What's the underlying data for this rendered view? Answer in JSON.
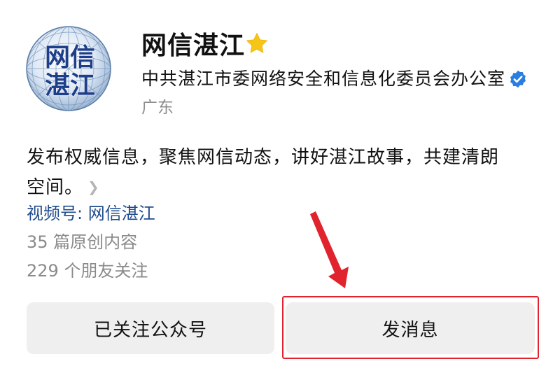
{
  "account": {
    "name": "网信湛江",
    "organization": "中共湛江市委网络安全和信息化委员会办公室",
    "region": "广东",
    "logo_text_line1": "网信",
    "logo_text_line2": "湛江"
  },
  "profile": {
    "description": "发布权威信息，聚焦网信动态，讲好湛江故事，共建清朗空间。",
    "channel": "视频号: 网信湛江",
    "articles": "35 篇原创内容",
    "followers": "229 个朋友关注"
  },
  "actions": {
    "follow_label": "已关注公众号",
    "message_label": "发消息"
  },
  "icons": {
    "star": "star-icon",
    "verified": "verified-badge-icon",
    "chevron": "chevron-right-icon",
    "annotation_arrow": "red-arrow-annotation"
  },
  "colors": {
    "star": "#f5c518",
    "verified": "#2a7de1",
    "channel_link": "#1f4c8c",
    "secondary_text": "#8a8a8a",
    "annotation_red": "#e0232c",
    "button_bg": "#efefef"
  }
}
